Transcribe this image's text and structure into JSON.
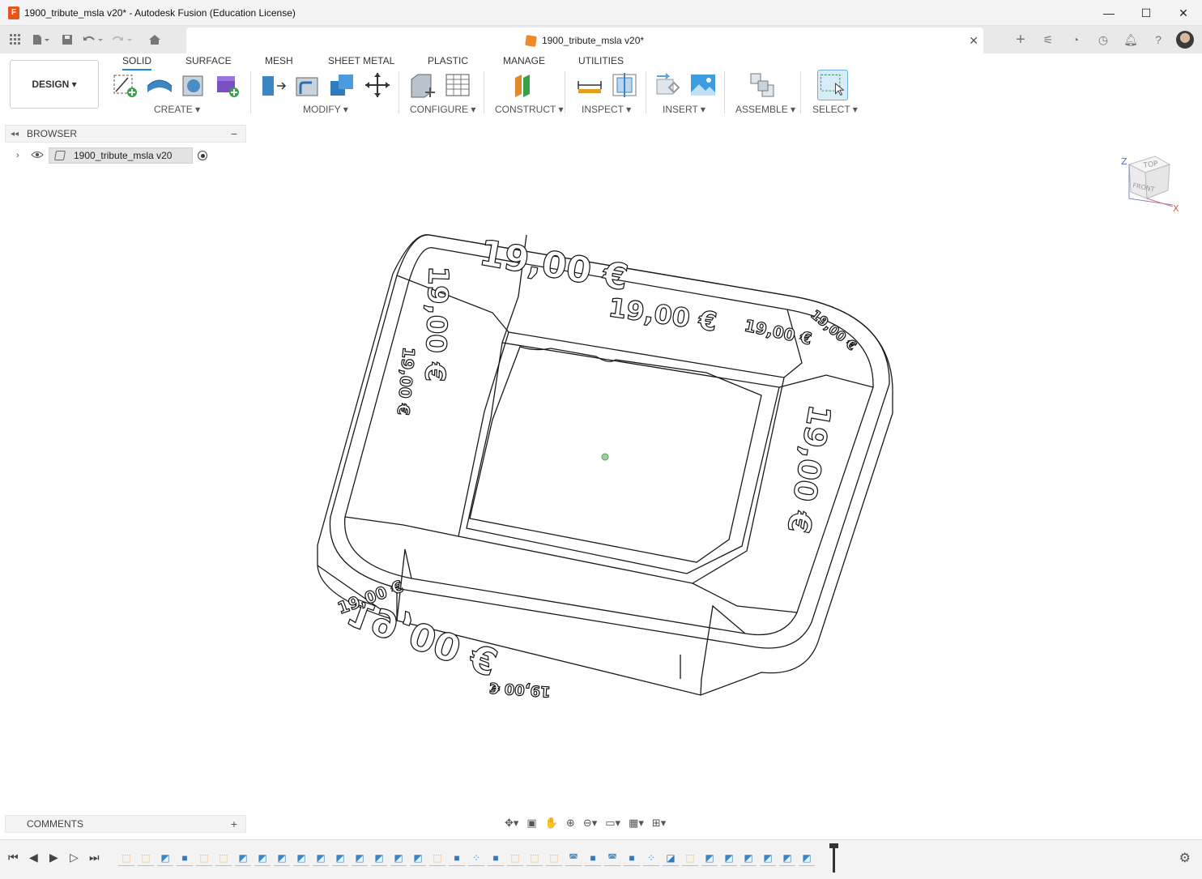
{
  "window": {
    "title": "1900_tribute_msla v20* - Autodesk Fusion (Education License)",
    "minimize": "—",
    "maximize": "☐",
    "close": "✕"
  },
  "tab": {
    "label": "1900_tribute_msla v20*",
    "close": "✕"
  },
  "ribbon": {
    "workspace": "DESIGN ▾",
    "tabs": [
      "SOLID",
      "SURFACE",
      "MESH",
      "SHEET METAL",
      "PLASTIC",
      "MANAGE",
      "UTILITIES"
    ],
    "groups": [
      "CREATE ▾",
      "MODIFY ▾",
      "CONFIGURE ▾",
      "CONSTRUCT ▾",
      "INSPECT ▾",
      "INSERT ▾",
      "ASSEMBLE ▾",
      "SELECT ▾"
    ]
  },
  "browser": {
    "title": "BROWSER",
    "collapse": "◂◂",
    "minimize": "−",
    "root_label": "1900_tribute_msla v20"
  },
  "comments": {
    "title": "COMMENTS",
    "add": "+"
  },
  "viewcube": {
    "top": "TOP",
    "front": "FRONT",
    "z": "Z",
    "x": "X"
  },
  "model_text": {
    "big": "19,00 €",
    "small": "19,00 €"
  },
  "colors": {
    "accent": "#1b8ad8",
    "model_line": "#1a1a1a",
    "app_orange": "#e8541e"
  },
  "icons": {
    "app": "autodesk-fusion-icon",
    "grid": "data-panel-icon",
    "file": "file-icon",
    "save": "save-icon",
    "undo": "undo-icon",
    "redo": "redo-icon",
    "home": "home-icon",
    "gear": "settings-gear-icon"
  }
}
